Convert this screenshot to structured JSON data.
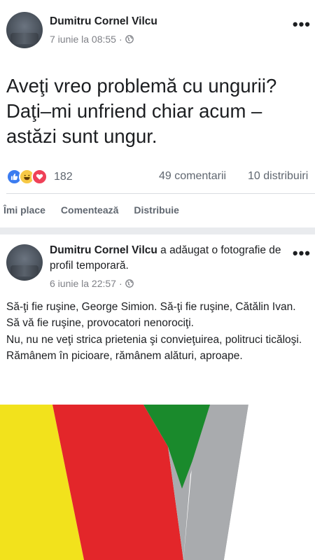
{
  "post1": {
    "author": "Dumitru Cornel Vilcu",
    "date": "7 iunie la 08:55",
    "separator": "·",
    "text": "Aveţi vreo problemă cu ungurii?\nDaţi–mi unfriend chiar acum –\nastăzi sunt ungur.",
    "reactions": [
      "like-icon",
      "haha-icon",
      "love-icon"
    ],
    "reaction_count": "182",
    "comments": "49 comentarii",
    "shares": "10 distribuiri",
    "actions": {
      "like": "Îmi place",
      "comment": "Comentează",
      "share": "Distribuie"
    },
    "more": "•••"
  },
  "post2": {
    "author": "Dumitru Cornel Vilcu",
    "action_text": " a adăugat o fotografie de profil temporară.",
    "date": "6 iunie la 22:57",
    "separator": "·",
    "paragraphs": [
      "Să-ţi fie ruşine, George Simion. Să-ţi fie ruşine, Cătălin Ivan.",
      "Să vă fie ruşine, provocatori nenorociţi.",
      "Nu, nu ne veţi strica prietenia şi convieţuirea, politruci ticăloşi.",
      "Rămânem în picioare, rămânem alături, aproape."
    ],
    "more": "•••"
  },
  "colors": {
    "separator_bg": "#e9ebee",
    "meta": "#7f8187",
    "like": "#3b7cf0",
    "haha": "#f7c945",
    "love": "#ef4158",
    "flag_yellow": "#f2e21c",
    "flag_red": "#e3262a",
    "flag_green": "#1a8a2c",
    "flag_gray": "#a9abae"
  }
}
